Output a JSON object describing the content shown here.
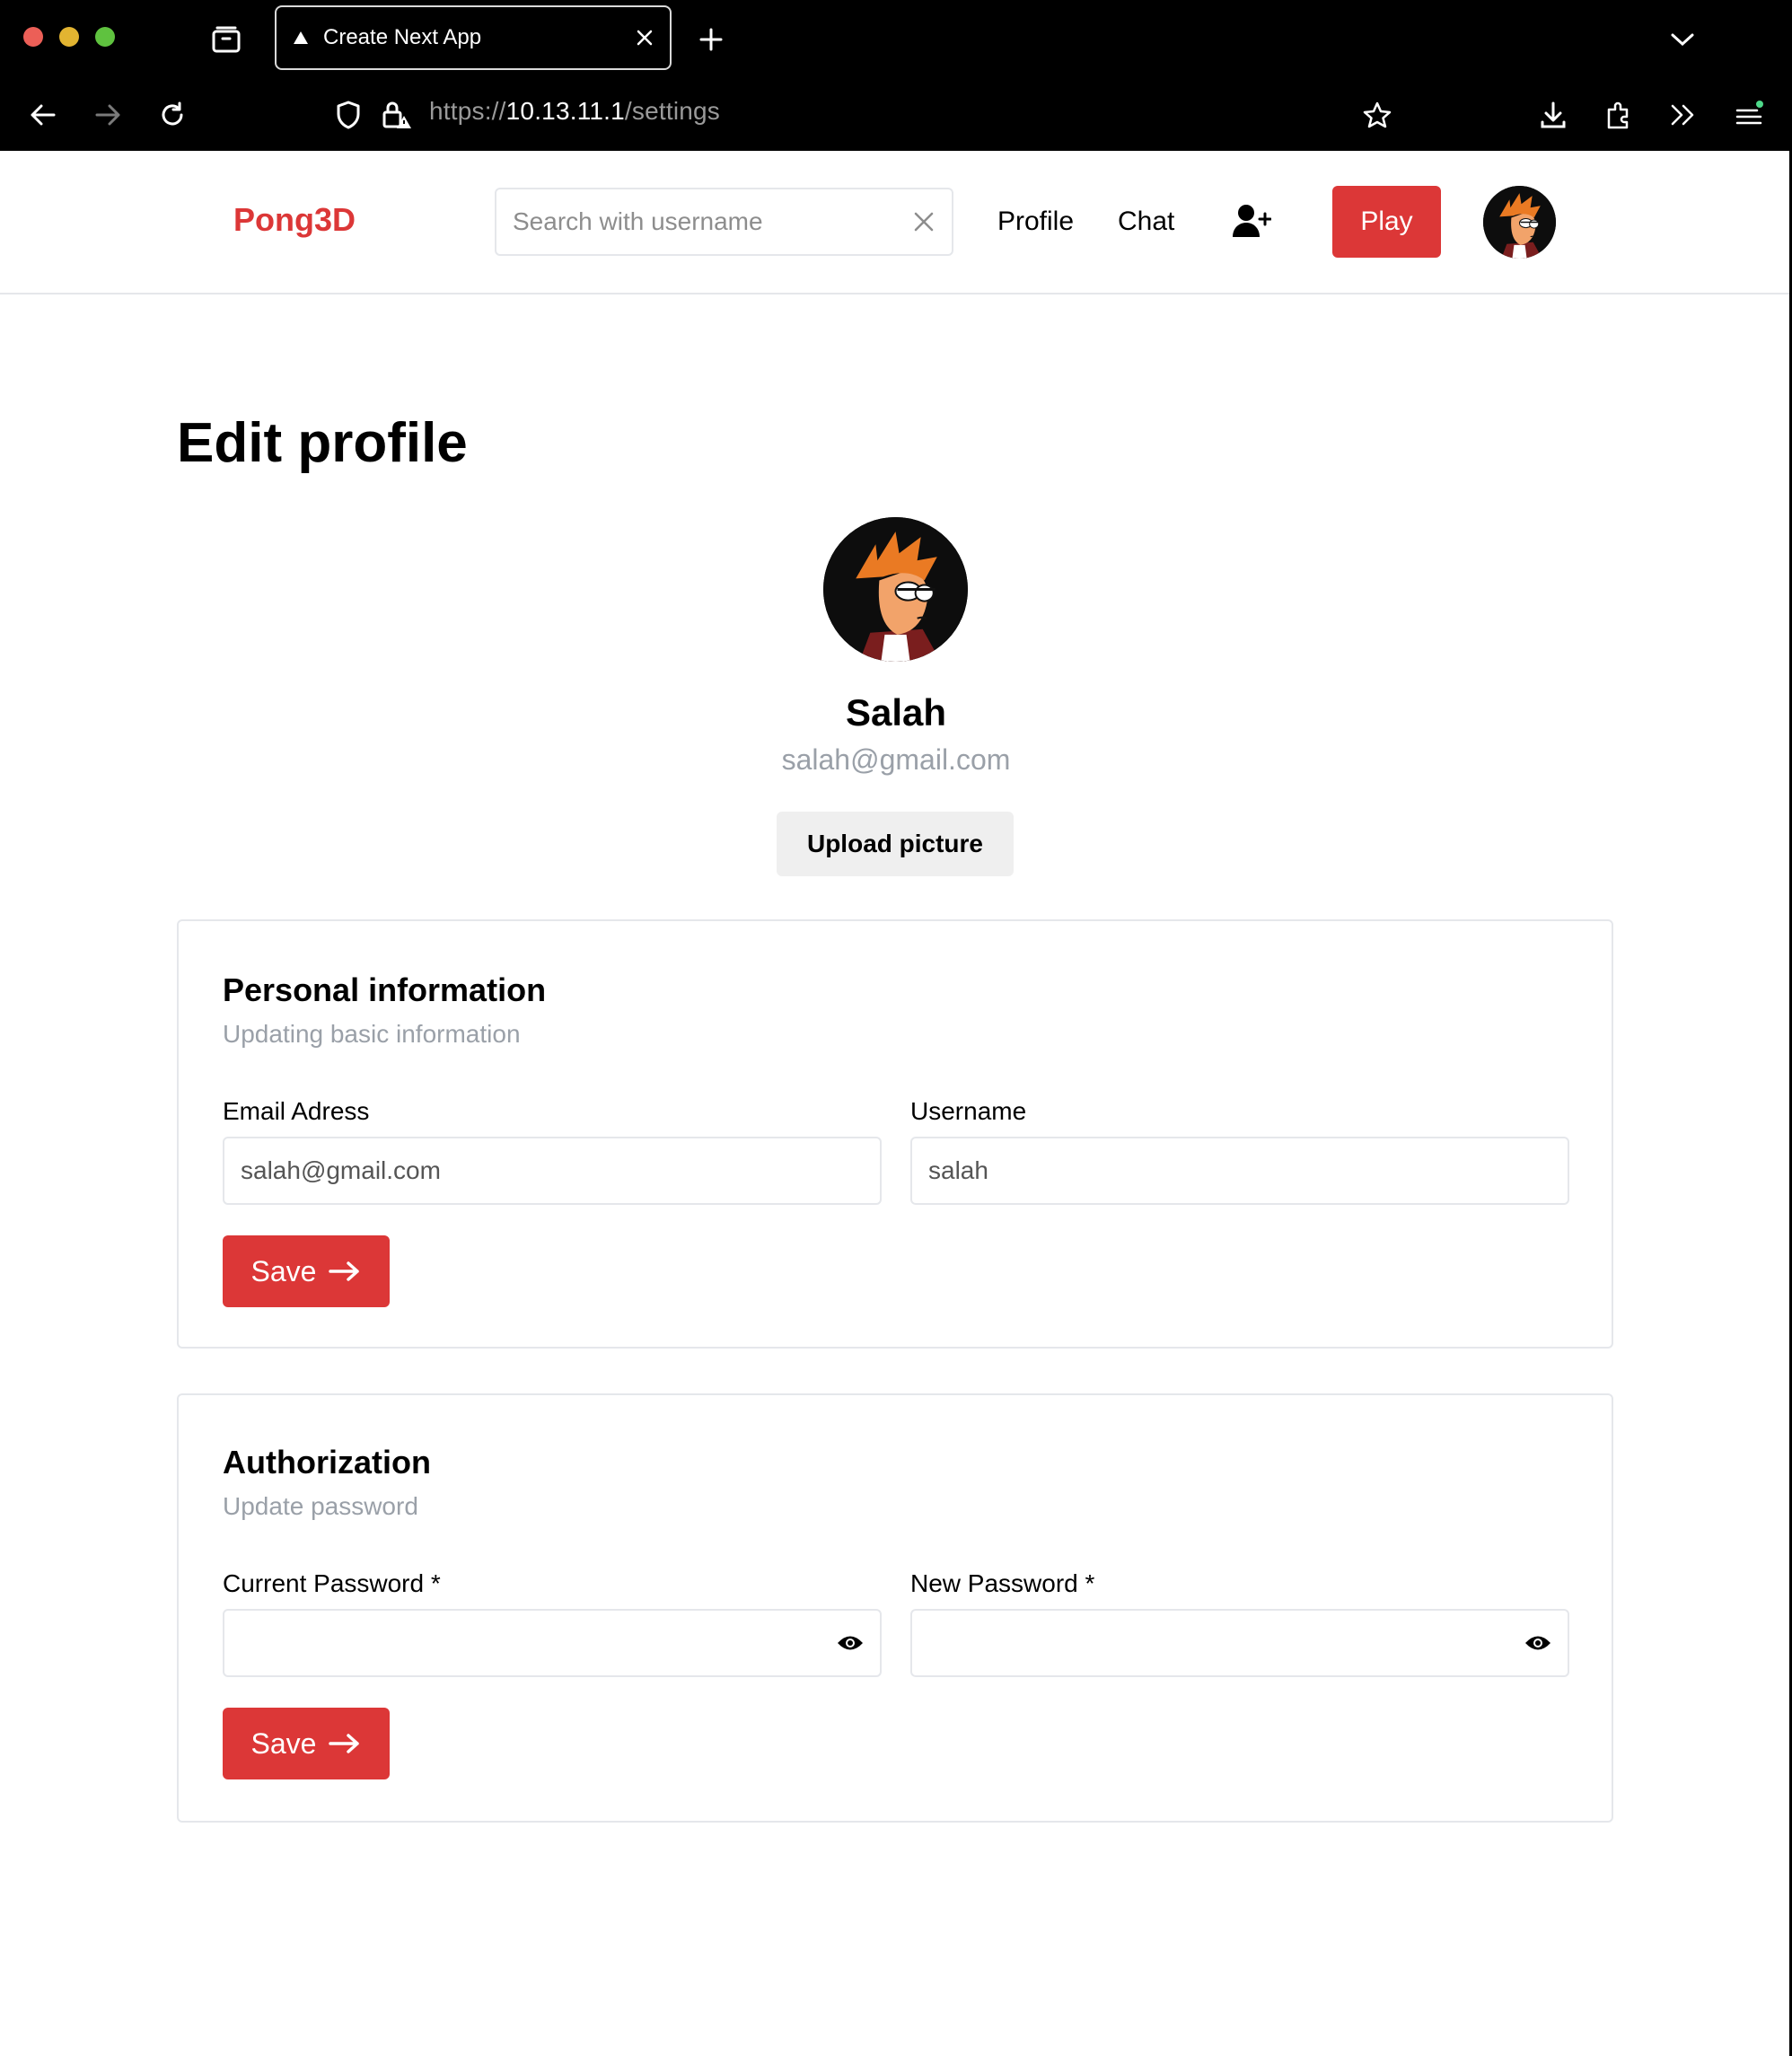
{
  "browser": {
    "tab_title": "Create Next App",
    "url_prefix": "https://",
    "url_host": "10.13.11.1",
    "url_path": "/settings"
  },
  "navbar": {
    "brand": "Pong3D",
    "search_placeholder": "Search with username",
    "links": [
      "Profile",
      "Chat"
    ],
    "play_label": "Play"
  },
  "page": {
    "title": "Edit profile",
    "user_name": "Salah",
    "user_email": "salah@gmail.com",
    "upload_label": "Upload picture"
  },
  "personal": {
    "title": "Personal information",
    "subtitle": "Updating basic information",
    "email_label": "Email Adress",
    "email_value": "salah@gmail.com",
    "username_label": "Username",
    "username_value": "salah",
    "save_label": "Save"
  },
  "auth": {
    "title": "Authorization",
    "subtitle": "Update password",
    "current_label": "Current Password *",
    "new_label": "New Password *",
    "save_label": "Save"
  },
  "colors": {
    "accent": "#dc3737",
    "muted": "#9aa0a8",
    "border": "#e5e7eb"
  }
}
